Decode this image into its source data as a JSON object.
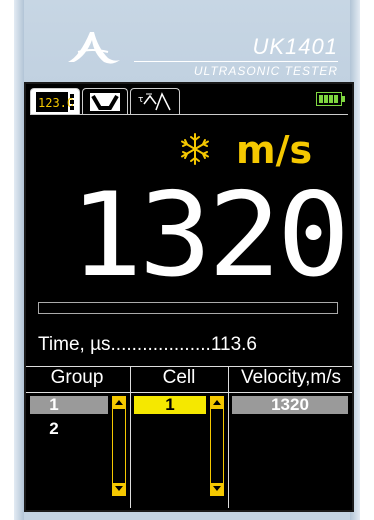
{
  "header": {
    "model": "UK1401",
    "subtitle": "ULTRASONIC TESTER"
  },
  "tabs": [
    {
      "label": "123.0",
      "icon": "numeric-display-icon",
      "active": true
    },
    {
      "label": "",
      "icon": "waveform-icon",
      "active": false
    },
    {
      "label": "",
      "icon": "time-graph-icon",
      "active": false
    }
  ],
  "status": {
    "battery": "full",
    "temperature_icon": "snowflake-icon"
  },
  "reading": {
    "value": "1320",
    "unit": "m/s",
    "progress": 0.0
  },
  "time": {
    "label": "Time, µs",
    "dots": "...................",
    "value": "113.6"
  },
  "table": {
    "headers": [
      "Group",
      "Cell",
      "Velocity,m/s"
    ],
    "groups": [
      "1",
      "2"
    ],
    "cells": [
      "1"
    ],
    "velocities": [
      "1320"
    ]
  },
  "colors": {
    "accent": "#f5c800",
    "selection": "#9a9a9a",
    "screen": "#000000",
    "battery": "#7fd640"
  }
}
